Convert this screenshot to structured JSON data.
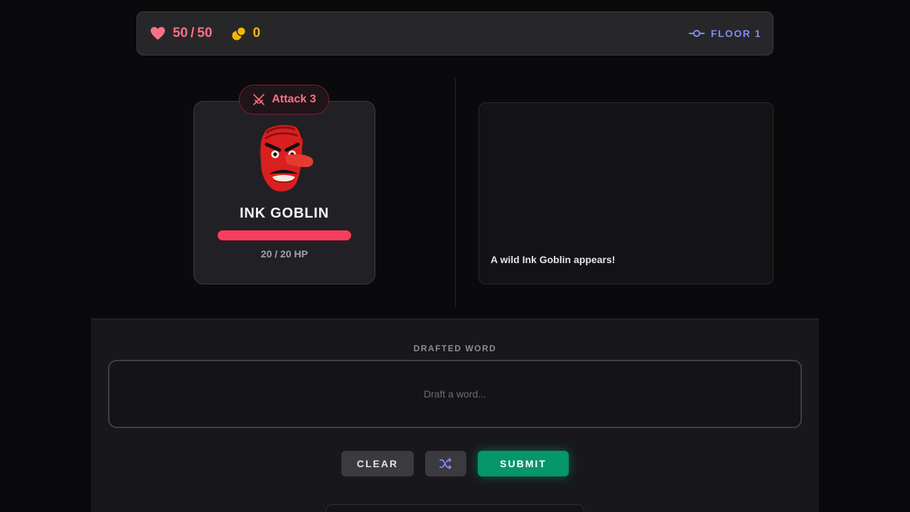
{
  "player": {
    "hp_current": "50",
    "hp_separator": "/",
    "hp_max": "50",
    "gold": "0"
  },
  "floor": {
    "label": "FLOOR 1"
  },
  "enemy": {
    "intent_label": "Attack 3",
    "name": "INK GOBLIN",
    "hp_text": "20 / 20 HP",
    "hp_fraction": 1.0,
    "portrait_icon": "red-tengu-mask"
  },
  "battle_log": {
    "lines": [
      "A wild Ink Goblin appears!"
    ]
  },
  "draft": {
    "label": "DRAFTED WORD",
    "placeholder": "Draft a word..."
  },
  "actions": {
    "clear_label": "CLEAR",
    "shuffle_icon": "shuffle-icon",
    "submit_label": "SUBMIT"
  },
  "colors": {
    "hp": "#fb7185",
    "gold": "#f5b50b",
    "floor": "#818cf8",
    "enemy_hp_bar": "#f43f5e",
    "submit": "#059669"
  }
}
